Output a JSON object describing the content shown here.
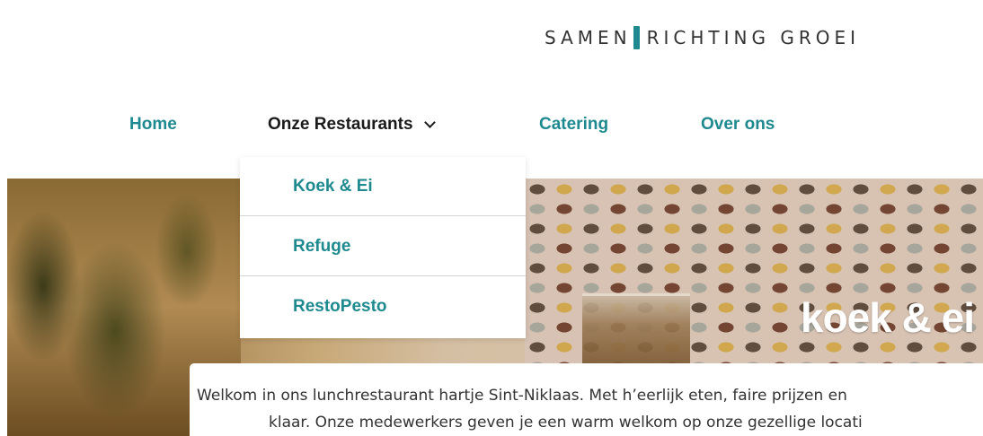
{
  "logo": {
    "left_word": "SAMEN",
    "right_word": "RICHTING GROEI"
  },
  "nav": {
    "items": [
      {
        "label": "Home"
      },
      {
        "label": "Onze Restaurants"
      },
      {
        "label": "Catering"
      },
      {
        "label": "Over ons"
      }
    ]
  },
  "dropdown": {
    "items": [
      {
        "label": "Koek & Ei"
      },
      {
        "label": "Refuge"
      },
      {
        "label": "RestoPesto"
      }
    ]
  },
  "hero": {
    "title": "koek & ei"
  },
  "intro": {
    "line1": "Welkom in ons lunchrestaurant hartje Sint-Niklaas. Met h’eerlijk eten, faire prijzen en ",
    "line2": "klaar. Onze medewerkers geven je een warm welkom op onze gezellige locati"
  },
  "colors": {
    "accent": "#1e8a8f",
    "text_dark": "#1a1a1a"
  },
  "icons": {
    "dropdown_chevron": "chevron-down-icon"
  }
}
